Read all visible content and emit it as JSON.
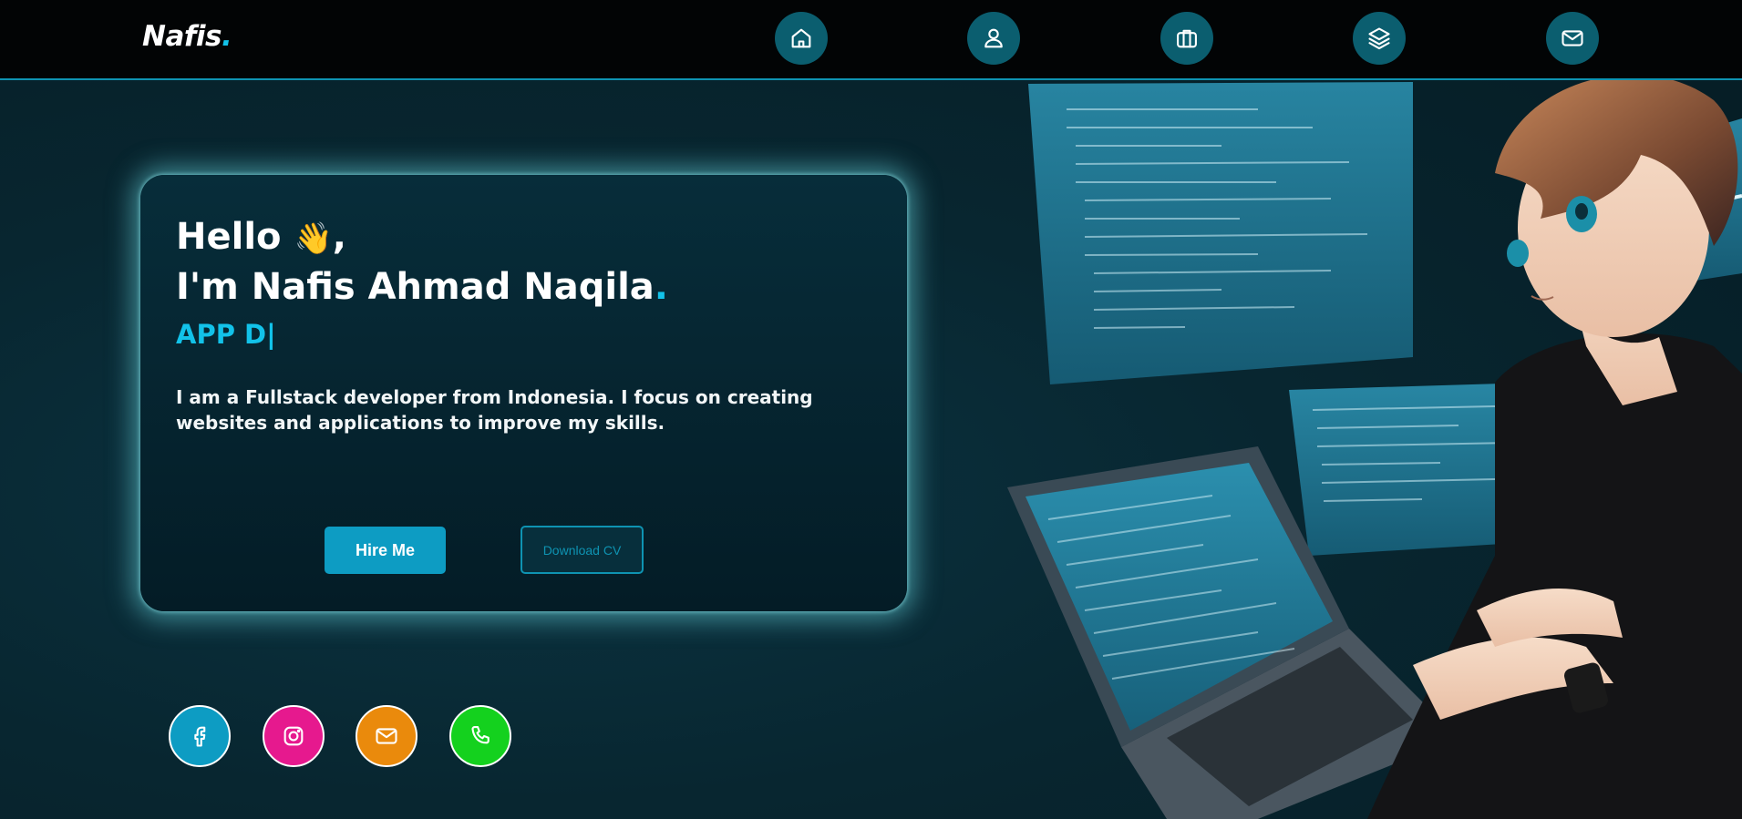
{
  "header": {
    "logo_text": "Nafis",
    "logo_dot": ".",
    "nav": [
      {
        "name": "home",
        "icon": "home-icon"
      },
      {
        "name": "about",
        "icon": "user-icon"
      },
      {
        "name": "portfolio",
        "icon": "briefcase-icon"
      },
      {
        "name": "services",
        "icon": "layers-icon"
      },
      {
        "name": "contact",
        "icon": "mail-icon"
      }
    ]
  },
  "hero": {
    "greeting": "Hello",
    "wave_emoji": "👋",
    "greeting_suffix": ",",
    "name_line": "I'm Nafis Ahmad Naqila",
    "name_dot": ".",
    "typed_role": "APP D|",
    "description": "I am a Fullstack developer from Indonesia. I focus on creating websites and applications to improve my skills.",
    "hire_button": "Hire Me",
    "cv_button": "Download CV"
  },
  "socials": [
    {
      "name": "facebook",
      "icon": "facebook-icon",
      "color": "#0d9cc3"
    },
    {
      "name": "instagram",
      "icon": "instagram-icon",
      "color": "#e6198e"
    },
    {
      "name": "email",
      "icon": "mail-icon",
      "color": "#ea8a0c"
    },
    {
      "name": "phone",
      "icon": "phone-icon",
      "color": "#14d11e"
    }
  ],
  "colors": {
    "accent": "#12c2e9",
    "topbar_border": "#0e93b2",
    "nav_button": "#0b5e6f"
  }
}
